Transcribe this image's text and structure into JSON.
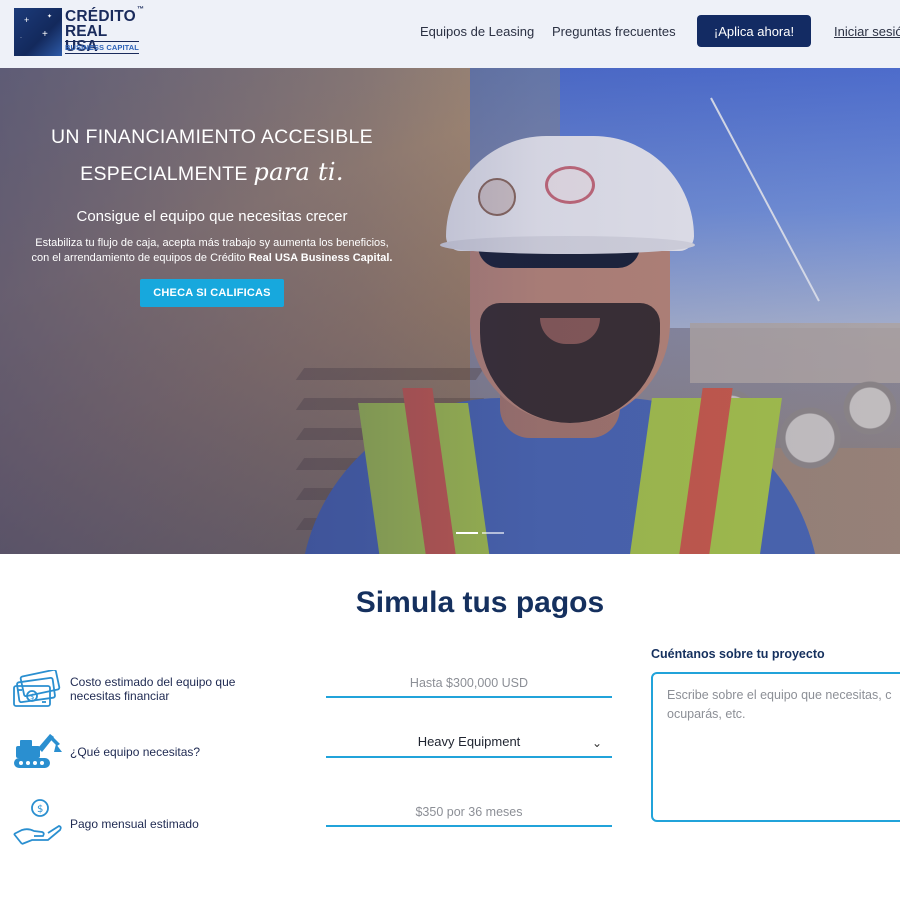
{
  "brand": {
    "line1": "CRÉDITO",
    "line2": "REAL USA",
    "line3": "BUSINESS CAPITAL",
    "tm": "™",
    "colors": {
      "navy": "#132b63",
      "accent": "#17a8dd"
    }
  },
  "nav": {
    "leasing": "Equipos de Leasing",
    "faq": "Preguntas frecuentes",
    "apply": "¡Aplica ahora!",
    "login": "Iniciar sesión"
  },
  "hero": {
    "title_line1": "UN FINANCIAMIENTO ACCESIBLE",
    "title_line2_prefix": "ESPECIALMENTE",
    "title_line2_script": "para ti.",
    "subtitle": "Consigue el equipo que necesitas crecer",
    "body_line1": "Estabiliza tu flujo de caja, acepta más trabajo sy aumenta los beneficios,",
    "body_line2_prefix": "con el arrendamiento de equipos de Crédito",
    "body_line2_bold": "Real USA Business Capital.",
    "cta": "CHECA SI CALIFICAS"
  },
  "simulator": {
    "title": "Simula tus pagos",
    "rows": [
      {
        "label": "Costo estimado del equipo que necesitas financiar",
        "placeholder": "Hasta $300,000 USD",
        "icon": "money-bills-icon"
      },
      {
        "label": "¿Qué equipo necesitas?",
        "selected": "Heavy Equipment",
        "icon": "excavator-icon"
      },
      {
        "label": "Pago mensual estimado",
        "placeholder": "$350 por 36 meses",
        "icon": "hand-coin-icon"
      }
    ],
    "project_label": "Cuéntanos sobre tu proyecto",
    "project_placeholder": "Escribe sobre el equipo que necesitas, c ocuparás, etc."
  }
}
